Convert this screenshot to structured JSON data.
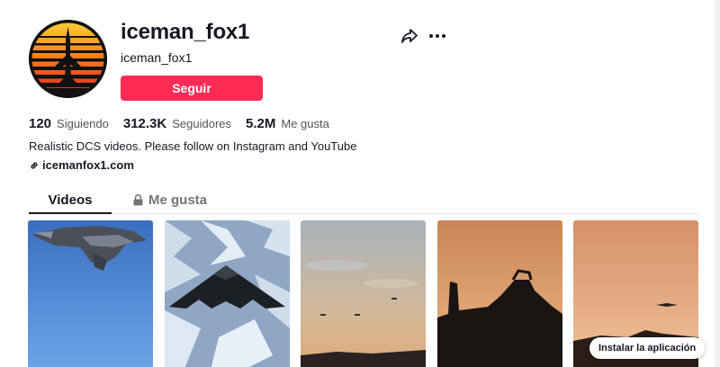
{
  "profile": {
    "username": "iceman_fox1",
    "nickname": "iceman_fox1",
    "follow_label": "Seguir",
    "avatar_icon": "fighter-jet-sunset-avatar"
  },
  "actions": {
    "share_icon": "share-arrow-icon",
    "more_icon": "more-dots-icon"
  },
  "stats": {
    "following_count": "120",
    "following_label": "Siguiendo",
    "followers_count": "312.3K",
    "followers_label": "Seguidores",
    "likes_count": "5.2M",
    "likes_label": "Me gusta"
  },
  "bio": "Realistic DCS videos. Please follow on Instagram and YouTube",
  "link": {
    "text": "icemanfox1.com",
    "icon": "link-icon"
  },
  "tabs": [
    {
      "label": "Videos",
      "active": true
    },
    {
      "label": "Me gusta",
      "active": false,
      "icon": "lock-icon"
    }
  ],
  "videos": [
    {
      "subject": "stealth fighter in blue sky"
    },
    {
      "subject": "stealth bomber over snowy mountains"
    },
    {
      "subject": "aircraft formation at dusk"
    },
    {
      "subject": "fighter jet silhouette at sunset"
    },
    {
      "subject": "aircraft silhouette over mountains at sunset"
    }
  ],
  "install_prompt": "Instalar la aplicación",
  "colors": {
    "accent": "#fe2c55",
    "text_primary": "#161823",
    "text_secondary": "#757575"
  }
}
